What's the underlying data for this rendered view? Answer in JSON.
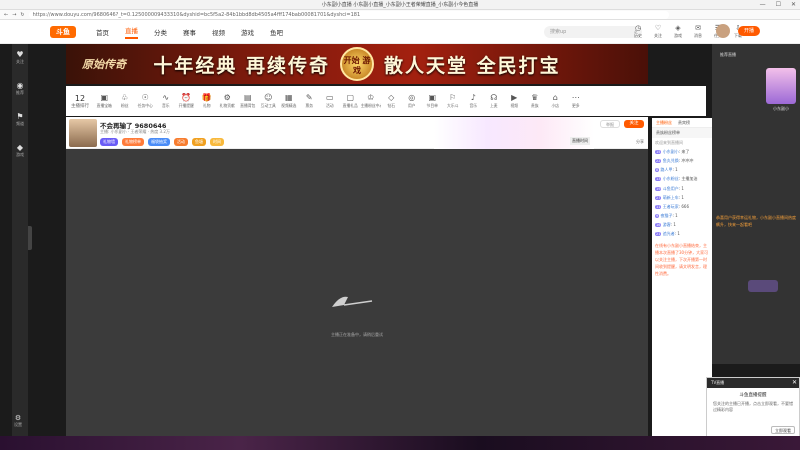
{
  "window": {
    "title": "小东副小直播 小东副小直播_小东副小王者荣耀直播_小东副小今色直播",
    "controls": [
      "—",
      "☐",
      "✕"
    ]
  },
  "browser": {
    "url": "https://www.douyu.com/9680646?_t=0.125000009433310&dyshid=bc5f5a2-84b1bbd8db4505a4fff174bab00081701&dyshci=181"
  },
  "header": {
    "logo": "斗鱼",
    "nav": [
      "首页",
      "直播",
      "分类",
      "赛事",
      "视频",
      "游戏",
      "鱼吧"
    ],
    "active_nav": "直播",
    "search_placeholder": "搜索up",
    "icons": [
      {
        "name": "history-icon",
        "glyph": "◷",
        "label": "历史"
      },
      {
        "name": "follow-icon",
        "glyph": "♡",
        "label": "关注"
      },
      {
        "name": "game-icon",
        "glyph": "◈",
        "label": "游戏"
      },
      {
        "name": "message-icon",
        "glyph": "✉",
        "label": "消息"
      },
      {
        "name": "task-icon",
        "glyph": "☰",
        "label": "任务"
      },
      {
        "name": "download-icon",
        "glyph": "⇩",
        "label": "下载"
      }
    ],
    "live_button": "开播"
  },
  "leftbar": {
    "items": [
      {
        "name": "follow-nav-icon",
        "glyph": "♥",
        "label": "关注"
      },
      {
        "name": "recommend-nav-icon",
        "glyph": "◉",
        "label": "推荐"
      },
      {
        "name": "category-nav-icon",
        "glyph": "⚑",
        "label": "频道"
      },
      {
        "name": "game-nav-icon",
        "glyph": "◆",
        "label": "游戏"
      }
    ],
    "bottom_label": "设置"
  },
  "banner": {
    "logo": "原始传奇",
    "slogan_left": "十年经典 再续传奇",
    "badge": "开始 游戏",
    "slogan_right": "散人天堂 全民打宝"
  },
  "giftbar": {
    "rank_num": "12",
    "rank_label": "主播排行",
    "items": [
      {
        "name": "box-icon",
        "glyph": "▣",
        "label": "直播宝箱"
      },
      {
        "name": "fan-icon",
        "glyph": "♧",
        "label": "粉丝"
      },
      {
        "name": "task-center-icon",
        "glyph": "☉",
        "label": "任务中心"
      },
      {
        "name": "wave-icon",
        "glyph": "∿",
        "label": "音乐"
      },
      {
        "name": "alarm-icon",
        "glyph": "⏰",
        "label": "开播提醒"
      },
      {
        "name": "gift-icon",
        "glyph": "🎁",
        "label": "礼物"
      },
      {
        "name": "car-icon",
        "glyph": "⚙",
        "label": "礼物贡献"
      },
      {
        "name": "bag-icon",
        "glyph": "▤",
        "label": "直播背包"
      },
      {
        "name": "emote-icon",
        "glyph": "☺",
        "label": "互动工具"
      },
      {
        "name": "grid-icon",
        "glyph": "▦",
        "label": "视频精选"
      },
      {
        "name": "ticket-icon",
        "glyph": "✎",
        "label": "票务"
      },
      {
        "name": "calendar-icon",
        "glyph": "▭",
        "label": "活动"
      },
      {
        "name": "present-icon",
        "glyph": "▢",
        "label": "直播礼品"
      },
      {
        "name": "crown-icon",
        "glyph": "♔",
        "label": "主播粉丝中心"
      },
      {
        "name": "diamond-icon",
        "glyph": "◇",
        "label": "钻石"
      },
      {
        "name": "user-icon",
        "glyph": "◎",
        "label": "用户"
      },
      {
        "name": "tv-icon",
        "glyph": "▣",
        "label": "节目单"
      },
      {
        "name": "flag-icon",
        "glyph": "⚐",
        "label": "大乐斗"
      },
      {
        "name": "music-icon",
        "glyph": "♪",
        "label": "音乐"
      },
      {
        "name": "mic-icon",
        "glyph": "☊",
        "label": "上麦"
      },
      {
        "name": "play-icon",
        "glyph": "▶",
        "label": "视频"
      },
      {
        "name": "vip-icon",
        "glyph": "♛",
        "label": "贵族"
      },
      {
        "name": "shop-icon",
        "glyph": "⌂",
        "label": "小店"
      },
      {
        "name": "more-icon",
        "glyph": "⋯",
        "label": "更多"
      }
    ]
  },
  "room": {
    "streamer": "不会再输了 9680646",
    "meta": "主播: 小东副小 · 王者荣耀 · 热度 3.2万",
    "tags": [
      {
        "text": "礼物墙",
        "color": "#6a5cf6"
      },
      {
        "text": "礼物榜单",
        "color": "#ff7b3a"
      },
      {
        "text": "福袋抽奖",
        "color": "#4a8cf7"
      },
      {
        "text": "活动",
        "color": "#f77c2e"
      },
      {
        "text": "鱼塘",
        "color": "#f0a020"
      },
      {
        "text": "时间",
        "color": "#f8b93c"
      }
    ],
    "report": "举报",
    "follow": "关注",
    "promo_label": "直播时间",
    "share": "分享"
  },
  "player": {
    "message": "主播正在准备中，请稍后重试"
  },
  "chat": {
    "tabs": [
      "主播粉丝",
      "贵宾榜"
    ],
    "top_label": "贵族粉丝榜单",
    "welcome": "欢迎来到直播间",
    "messages": [
      {
        "level": "15",
        "name": "小东副小",
        "text": "来了"
      },
      {
        "level": "22",
        "name": "鱼丸兑换",
        "text": "冲冲冲"
      },
      {
        "level": "8",
        "name": "路人甲",
        "text": "1"
      },
      {
        "level": "13",
        "name": "小东粉丝",
        "text": "主播加油"
      },
      {
        "level": "19",
        "name": "斗鱼用户",
        "text": "1"
      },
      {
        "level": "27",
        "name": "萌新上车",
        "text": "1"
      },
      {
        "level": "11",
        "name": "王者玩家",
        "text": "666"
      },
      {
        "level": "9",
        "name": "夜猫子",
        "text": "1"
      },
      {
        "level": "16",
        "name": "游客",
        "text": "1"
      },
      {
        "level": "21",
        "name": "追光者",
        "text": "1"
      }
    ],
    "notice": "在线有小东副小直播结束，主播本次直播了30分钟，大家可以关注主播，下次开播第一时间收到提醒，请文明发言，理性消费。"
  },
  "side": {
    "title": "推荐直播",
    "card_label": "小东副小",
    "promo": "恭喜用户获得幸运礼物，小东副小直播间热度飙升，快来一起看吧"
  },
  "popup": {
    "header": "TV直播",
    "title": "斗鱼直播提醒",
    "body": "您关注的主播已开播，点击立即观看，不要错过精彩内容",
    "button": "立即观看",
    "close": "✕"
  }
}
